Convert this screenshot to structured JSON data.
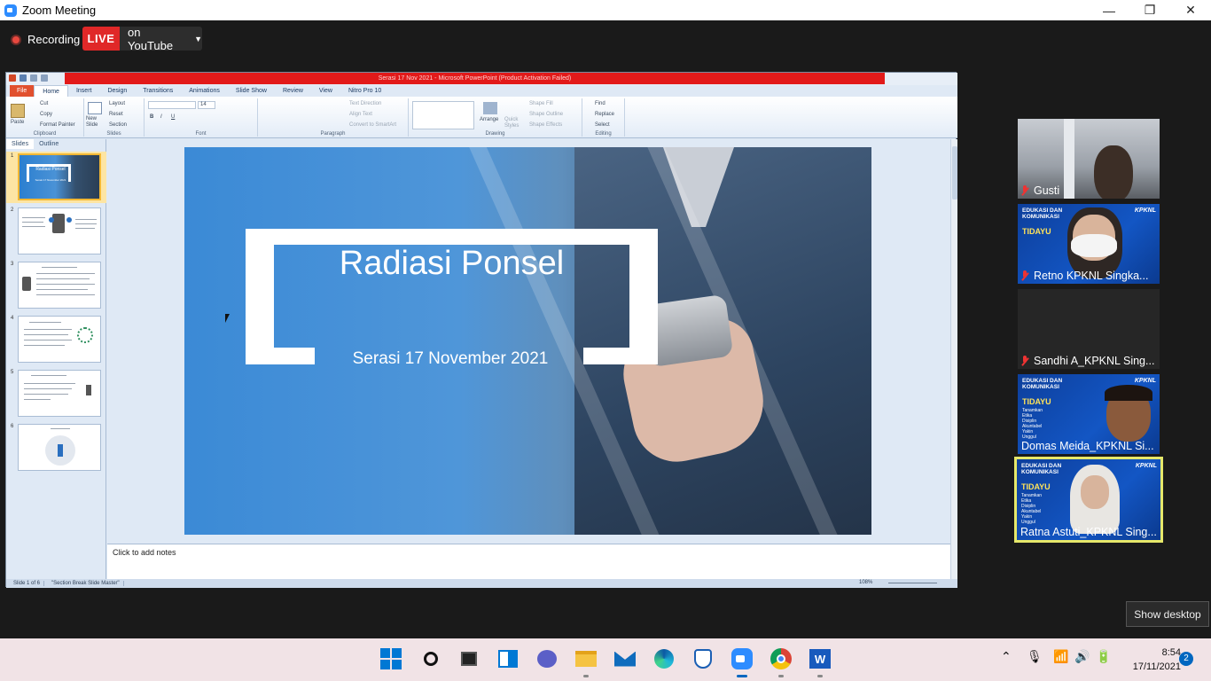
{
  "window": {
    "title": "Zoom Meeting",
    "controls": [
      "—",
      "❐",
      "✕"
    ]
  },
  "recording": {
    "label": "Recording",
    "live_badge": "LIVE",
    "stream_target": "on YouTube"
  },
  "ppt": {
    "title_bar": "Serasi 17 Nov 2021 - Microsoft PowerPoint (Product Activation Failed)",
    "tabs": [
      "File",
      "Home",
      "Insert",
      "Design",
      "Transitions",
      "Animations",
      "Slide Show",
      "Review",
      "View",
      "Nitro Pro 10"
    ],
    "ribbon": {
      "clipboard": {
        "label": "Clipboard",
        "paste": "Paste",
        "cut": "Cut",
        "copy": "Copy",
        "format_painter": "Format Painter"
      },
      "slides": {
        "label": "Slides",
        "new_slide": "New Slide",
        "layout": "Layout",
        "reset": "Reset",
        "section": "Section"
      },
      "font": {
        "label": "Font",
        "size": "14"
      },
      "paragraph": {
        "label": "Paragraph",
        "text_direction": "Text Direction",
        "align_text": "Align Text",
        "convert_smartart": "Convert to SmartArt"
      },
      "drawing": {
        "label": "Drawing",
        "arrange": "Arrange",
        "quick_styles": "Quick Styles",
        "shape_fill": "Shape Fill",
        "shape_outline": "Shape Outline",
        "shape_effects": "Shape Effects"
      },
      "editing": {
        "label": "Editing",
        "find": "Find",
        "replace": "Replace",
        "select": "Select"
      }
    },
    "panel_tabs": [
      "Slides",
      "Outline"
    ],
    "slide_numbers": [
      "1",
      "2",
      "3",
      "4",
      "5",
      "6"
    ],
    "slide": {
      "title": "Radiasi Ponsel",
      "subtitle": "Serasi 17 November 2021"
    },
    "thumb1": {
      "title": "Radiasi Ponsel",
      "subtitle": "Serasi 17 November 2021"
    },
    "notes_placeholder": "Click to add notes",
    "status": {
      "slide_count": "Slide 1 of 6",
      "theme": "\"Section Break Slide Master\"",
      "zoom": "108%"
    }
  },
  "participants": [
    {
      "name": "Gusti"
    },
    {
      "name": "Retno KPKNL Singka..."
    },
    {
      "name": "Sandhi A_KPKNL Sing..."
    },
    {
      "name": "Domas Meida_KPKNL Si..."
    },
    {
      "name": "Ratna Astuti_KPKNL Sing..."
    }
  ],
  "kpknl_bg": {
    "heading": "EDUKASI DAN KOMUNIKASI",
    "brand": "KPKNL",
    "slogan": "TIDAYU",
    "lines": [
      "Tanamkan",
      "Etika",
      "Disiplin",
      "Akuntabel",
      "Yakin",
      "Unggul"
    ]
  },
  "show_desktop": "Show desktop",
  "taskbar": {
    "apps": [
      "windows-start",
      "search",
      "task-view",
      "widgets",
      "teams-chat",
      "file-explorer",
      "mail",
      "edge",
      "security",
      "zoom",
      "chrome",
      "word"
    ],
    "time": "8:54",
    "date": "17/11/2021",
    "notifications": "2"
  },
  "colors": {
    "zoom_bg": "#1a1a1a",
    "live_red": "#e02828",
    "ppt_file_tab": "#e1502e",
    "slide_blue": "#3b8ad6",
    "active_speaker": "#e6e86a"
  }
}
